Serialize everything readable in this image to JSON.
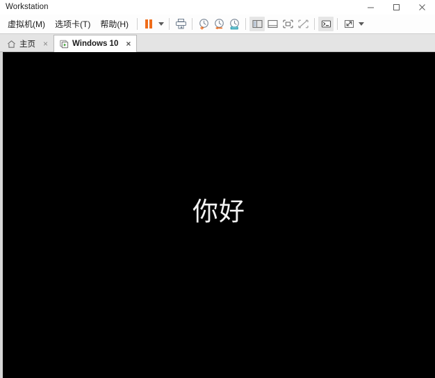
{
  "window": {
    "title": "Workstation",
    "controls": [
      {
        "name": "minimize-button",
        "glyph": "minimize"
      },
      {
        "name": "maximize-button",
        "glyph": "maximize"
      },
      {
        "name": "close-button",
        "glyph": "close"
      }
    ]
  },
  "menu": {
    "items": [
      {
        "label": "虚拟机(M)",
        "name": "menu-virtual-machine"
      },
      {
        "label": "选项卡(T)",
        "name": "menu-tabs"
      },
      {
        "label": "帮助(H)",
        "name": "menu-help"
      }
    ]
  },
  "toolbar": {
    "buttons": [
      {
        "name": "suspend-button",
        "icon": "pause-icon",
        "title": "挂起"
      },
      {
        "name": "suspend-dropdown",
        "icon": "chevron-down-icon",
        "title": ""
      },
      {
        "name": "send-ctrl-alt-del-button",
        "icon": "send-keys-icon",
        "title": "发送 Ctrl+Alt+Delete"
      },
      {
        "name": "take-snapshot-button",
        "icon": "snapshot-add-icon",
        "title": "拍摄此虚拟机的快照"
      },
      {
        "name": "revert-snapshot-button",
        "icon": "snapshot-revert-icon",
        "title": "恢复到快照"
      },
      {
        "name": "snapshot-manager-button",
        "icon": "snapshot-manager-icon",
        "title": "管理快照"
      },
      {
        "name": "show-library-button",
        "icon": "sidebar-panel-icon",
        "title": "显示或隐藏库"
      },
      {
        "name": "show-thumbnail-bar-button",
        "icon": "thumbnail-bar-icon",
        "title": "显示或隐藏缩略图栏"
      },
      {
        "name": "show-console-view-button",
        "icon": "console-view-icon",
        "title": "显示控制台视图"
      },
      {
        "name": "hide-console-view-button",
        "icon": "console-view-off-icon",
        "title": "隐藏控制台视图"
      },
      {
        "name": "unity-mode-button",
        "icon": "terminal-icon",
        "title": "Unity 模式"
      },
      {
        "name": "fullscreen-button",
        "icon": "expand-icon",
        "title": "进入全屏模式"
      },
      {
        "name": "fullscreen-dropdown",
        "icon": "chevron-down-icon",
        "title": ""
      }
    ]
  },
  "tabs": [
    {
      "label": "主页",
      "icon": "home-icon",
      "name": "tab-home",
      "active": false,
      "close": "×"
    },
    {
      "label": "Windows 10",
      "icon": "vm-icon",
      "name": "tab-windows-10",
      "active": true,
      "close": "×"
    }
  ],
  "viewport": {
    "name": "vm-console",
    "guest_text": "你好",
    "background_color": "#000000",
    "text_color": "#f2f2f2"
  },
  "colors": {
    "accent_orange": "#ef6c1a",
    "tabstrip_bg": "#e4e4e4",
    "toolbar_bg": "#fdfdfd",
    "border": "#b8b8b8"
  }
}
